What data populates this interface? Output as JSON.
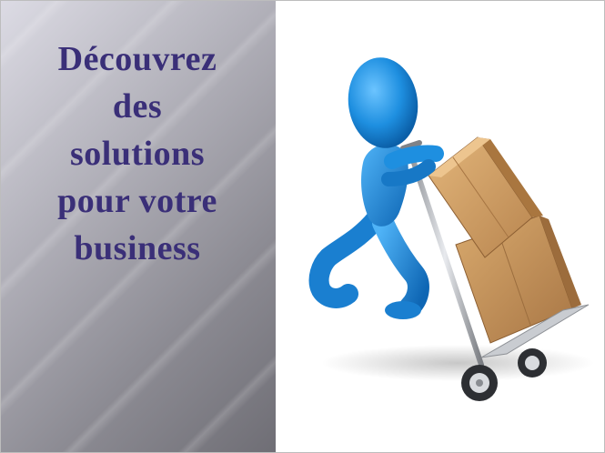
{
  "slide": {
    "headline_lines": [
      "Découvrez",
      "des",
      "solutions",
      "pour votre",
      "business"
    ]
  },
  "colors": {
    "headline": "#3a2f78",
    "figure": "#1e8fe0",
    "box": "#c9995e",
    "panel": "#8c8b93"
  },
  "illustration": {
    "icon": "person-pushing-hand-truck-with-boxes-icon"
  }
}
